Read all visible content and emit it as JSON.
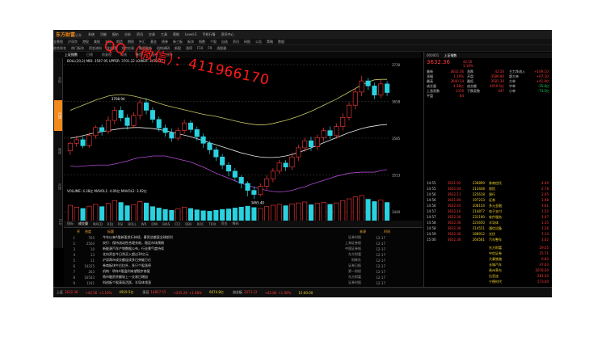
{
  "app": {
    "title": "东方财富",
    "subtitle": "证券"
  },
  "menu": [
    "系统",
    "功能",
    "报价",
    "分析",
    "资讯",
    "交易",
    "工具",
    "帮助",
    "Level-2",
    "手机行情",
    "资讯中心"
  ],
  "toolbar2": [
    "全景图",
    "沪深京",
    "港股",
    "美股",
    "全球",
    "期货",
    "期权",
    "外汇",
    "基金",
    "债券",
    "新三板",
    "板块",
    "指数",
    "个股",
    "自选",
    "资讯",
    "研报",
    "公告",
    "策略",
    "数据"
  ],
  "toolbar3": [
    "综合排名",
    "热门板块",
    "资金流向",
    "龙虎榜",
    "大宗交易",
    "融资融券",
    "机构调研",
    "新股",
    "涨停",
    "F10",
    "F9",
    "选股器"
  ],
  "chart_header": {
    "name": "上证指数",
    "items": [
      "日线",
      "前复权",
      "均线",
      "叠加",
      "画线",
      "统计"
    ]
  },
  "chart_info": {
    "ma": "BOLL(20,2)  MID: 3597.95  UPPER: 3701.22  LOWER: 3472.31",
    "high_label": "3708.94",
    "low_label": "3465.40",
    "mid_label": "3611.94"
  },
  "side_labels": [
    "分时",
    "日线",
    "周线",
    "月线",
    "F10"
  ],
  "bottom_tabs": [
    "指标",
    "成交量",
    "MACD",
    "KDJ",
    "RSI",
    "BOLL",
    "WR",
    "DMI",
    "BIAS",
    "CCI",
    "OBV",
    "ROC",
    "TRIX",
    "资金",
    "筹码"
  ],
  "vol_info": "VOLUME: 4.38亿  MAVOL1: 4.00亿  MAVOL2: 3.92亿",
  "news": {
    "header": [
      "序",
      "热度",
      "标题",
      "来源",
      "时间"
    ],
    "rows": [
      {
        "id": "1",
        "num": "765",
        "txt": "今年以来A股新股发行持续，募资总额居全球前列",
        "src": "证券时报",
        "tm": "12-17"
      },
      {
        "id": "2",
        "num": "2504",
        "txt": "央行：保持流动性合理充裕，稳定市场预期",
        "src": "上海证券报",
        "tm": "12-17"
      },
      {
        "id": "3",
        "num": "10",
        "txt": "新能源汽车产销数据公布，行业景气度持续",
        "src": "中国证券报",
        "tm": "12-17"
      },
      {
        "id": "4",
        "num": "13",
        "txt": "北向资金今日净买入超过30亿元",
        "src": "东方财富",
        "tm": "12-17"
      },
      {
        "id": "5",
        "num": "11",
        "txt": "沪深两市成交额连续多日突破万亿",
        "src": "财联社",
        "tm": "12-17"
      },
      {
        "id": "6",
        "num": "14225",
        "txt": "券商板块午后拉升，多只个股涨停",
        "src": "证券日报",
        "tm": "12-17"
      },
      {
        "id": "7",
        "num": "263",
        "txt": "机构：明年A股盈利有望稳步修复",
        "src": "第一财经",
        "tm": "12-17"
      },
      {
        "id": "8",
        "num": "16543",
        "txt": "两市融资余额较上一交易日增加",
        "src": "东方财富",
        "tm": "12-17"
      },
      {
        "id": "9",
        "num": "1241",
        "txt": "科创板个股表现活跃，半导体领涨",
        "src": "证券时报",
        "tm": "12-17"
      }
    ]
  },
  "quote": {
    "title": "上证指数",
    "code": "000001",
    "price": "3632.36",
    "change": "42.56",
    "pct": "1.19%",
    "fields": [
      {
        "k": "最新",
        "v": "3632.36"
      },
      {
        "k": "涨跌",
        "v": "42.56"
      },
      {
        "k": "涨幅",
        "v": "1.19%"
      },
      {
        "k": "开盘",
        "v": "3589.80"
      },
      {
        "k": "最高",
        "v": "3640.14"
      },
      {
        "k": "最低",
        "v": "3581.30"
      },
      {
        "k": "成交量",
        "v": "4.38亿"
      },
      {
        "k": "成交额",
        "v": "4919.5亿"
      },
      {
        "k": "上涨家数",
        "v": "1376"
      },
      {
        "k": "下跌家数",
        "v": "447"
      },
      {
        "k": "平盘",
        "v": "84"
      }
    ],
    "flow": [
      {
        "k": "主力净流入",
        "v": "+109.1亿"
      },
      {
        "k": "超大单",
        "v": "+67.2亿"
      },
      {
        "k": "大单",
        "v": "+41.9亿"
      },
      {
        "k": "中单",
        "v": "-35.6亿"
      },
      {
        "k": "小单",
        "v": "-73.5亿"
      }
    ],
    "ticks": [
      {
        "t": "14:55",
        "p": "3631.92",
        "v": "236899"
      },
      {
        "t": "14:55",
        "p": "3632.04",
        "v": "213448"
      },
      {
        "t": "14:56",
        "p": "3632.11",
        "v": "225618"
      },
      {
        "t": "14:56",
        "p": "3631.80",
        "v": "197233"
      },
      {
        "t": "14:56",
        "p": "3632.45",
        "v": "208154"
      },
      {
        "t": "14:57",
        "p": "3632.10",
        "v": "214877"
      },
      {
        "t": "14:57",
        "p": "3632.36",
        "v": "231190"
      },
      {
        "t": "14:58",
        "p": "3632.36",
        "v": "223650"
      },
      {
        "t": "14:58",
        "p": "3632.36",
        "v": "214551"
      },
      {
        "t": "14:59",
        "p": "3632.36",
        "v": "188912"
      },
      {
        "t": "15:00",
        "p": "3632.36",
        "v": "264561"
      }
    ],
    "sectors": [
      {
        "n": "券商信托",
        "p": "4.49"
      },
      {
        "n": "保险",
        "p": "2.78"
      },
      {
        "n": "银行",
        "p": "2.05"
      },
      {
        "n": "证券",
        "p": "1.98"
      },
      {
        "n": "多元金融",
        "p": "1.61"
      },
      {
        "n": "电子支付",
        "p": "1.52"
      },
      {
        "n": "软件服务",
        "p": "1.47"
      },
      {
        "n": "半导体",
        "p": "1.35"
      },
      {
        "n": "通信设备",
        "p": "1.26"
      },
      {
        "n": "光伏",
        "p": "1.14"
      },
      {
        "n": "汽车整车",
        "p": "1.02"
      }
    ],
    "stocks": [
      {
        "n": "东方财富",
        "p": "29.05"
      },
      {
        "n": "中信证券",
        "p": "25.71"
      },
      {
        "n": "大秦铁路",
        "p": "6.82"
      },
      {
        "n": "长城汽车",
        "p": "47.63"
      },
      {
        "n": "贵州茅台",
        "p": "2078.00"
      },
      {
        "n": "比亚迪",
        "p": "281.50"
      },
      {
        "n": "宁德时代",
        "p": "573.00"
      }
    ]
  },
  "status": [
    {
      "t": "上证",
      "v": "3632.36"
    },
    {
      "t": "+42.56",
      "v": "+1.19%"
    },
    {
      "t": "4919.5亿",
      "v": ""
    },
    {
      "t": "深证",
      "v": "14857.55"
    },
    {
      "t": "+245.26",
      "v": "+1.68%"
    },
    {
      "t": "6674.8亿",
      "v": ""
    },
    {
      "t": "创业板",
      "v": "3373.12"
    },
    {
      "t": "+62.80",
      "v": "+1.90%"
    },
    {
      "t": "15:00:00",
      "v": ""
    }
  ],
  "watermark": "QQ（微信）：411966170",
  "chart_data": {
    "type": "candlestick",
    "ylim": [
      3440,
      3730
    ],
    "candles": [
      [
        3560,
        3575,
        3552,
        3578
      ],
      [
        3575,
        3582,
        3568,
        3590
      ],
      [
        3582,
        3570,
        3565,
        3588
      ],
      [
        3570,
        3590,
        3566,
        3596
      ],
      [
        3590,
        3606,
        3584,
        3610
      ],
      [
        3606,
        3598,
        3590,
        3612
      ],
      [
        3598,
        3620,
        3594,
        3628
      ],
      [
        3620,
        3640,
        3612,
        3646
      ],
      [
        3640,
        3625,
        3618,
        3648
      ],
      [
        3625,
        3610,
        3602,
        3632
      ],
      [
        3610,
        3630,
        3604,
        3636
      ],
      [
        3630,
        3655,
        3622,
        3662
      ],
      [
        3655,
        3640,
        3632,
        3664
      ],
      [
        3640,
        3622,
        3615,
        3646
      ],
      [
        3622,
        3605,
        3598,
        3628
      ],
      [
        3605,
        3596,
        3588,
        3612
      ],
      [
        3596,
        3585,
        3578,
        3604
      ],
      [
        3585,
        3600,
        3580,
        3606
      ],
      [
        3600,
        3615,
        3594,
        3622
      ],
      [
        3615,
        3602,
        3596,
        3620
      ],
      [
        3602,
        3588,
        3580,
        3608
      ],
      [
        3588,
        3575,
        3566,
        3594
      ],
      [
        3575,
        3562,
        3554,
        3580
      ],
      [
        3562,
        3548,
        3540,
        3568
      ],
      [
        3548,
        3532,
        3524,
        3554
      ],
      [
        3532,
        3520,
        3510,
        3538
      ],
      [
        3520,
        3508,
        3500,
        3526
      ],
      [
        3508,
        3496,
        3486,
        3512
      ],
      [
        3496,
        3482,
        3470,
        3500
      ],
      [
        3482,
        3474,
        3465,
        3490
      ],
      [
        3474,
        3490,
        3470,
        3496
      ],
      [
        3490,
        3505,
        3484,
        3512
      ],
      [
        3505,
        3520,
        3498,
        3526
      ],
      [
        3520,
        3536,
        3514,
        3542
      ],
      [
        3536,
        3528,
        3520,
        3542
      ],
      [
        3528,
        3548,
        3522,
        3556
      ],
      [
        3548,
        3566,
        3540,
        3572
      ],
      [
        3566,
        3580,
        3558,
        3586
      ],
      [
        3580,
        3568,
        3560,
        3588
      ],
      [
        3568,
        3586,
        3562,
        3592
      ],
      [
        3586,
        3600,
        3578,
        3606
      ],
      [
        3600,
        3590,
        3584,
        3608
      ],
      [
        3590,
        3608,
        3584,
        3614
      ],
      [
        3608,
        3626,
        3600,
        3634
      ],
      [
        3626,
        3650,
        3620,
        3656
      ],
      [
        3650,
        3676,
        3642,
        3684
      ],
      [
        3676,
        3698,
        3668,
        3708
      ],
      [
        3698,
        3688,
        3680,
        3704
      ],
      [
        3688,
        3670,
        3662,
        3694
      ],
      [
        3670,
        3692,
        3664,
        3700
      ],
      [
        3692,
        3675,
        3668,
        3698
      ]
    ],
    "upper": [
      3640,
      3645,
      3650,
      3655,
      3660,
      3664,
      3668,
      3670,
      3671,
      3670,
      3668,
      3665,
      3662,
      3658,
      3654,
      3650,
      3647,
      3644,
      3641,
      3638,
      3635,
      3632,
      3630,
      3628,
      3625,
      3622,
      3619,
      3616,
      3614,
      3612,
      3611,
      3612,
      3614,
      3617,
      3620,
      3624,
      3628,
      3633,
      3638,
      3644,
      3650,
      3656,
      3662,
      3669,
      3676,
      3683,
      3690,
      3696,
      3700,
      3701,
      3701
    ],
    "mid": [
      3585,
      3587,
      3590,
      3593,
      3596,
      3598,
      3600,
      3602,
      3604,
      3605,
      3606,
      3606,
      3605,
      3604,
      3602,
      3600,
      3597,
      3594,
      3591,
      3588,
      3584,
      3580,
      3576,
      3572,
      3568,
      3564,
      3560,
      3556,
      3553,
      3550,
      3548,
      3547,
      3547,
      3548,
      3550,
      3553,
      3557,
      3561,
      3566,
      3571,
      3576,
      3581,
      3586,
      3591,
      3596,
      3600,
      3604,
      3607,
      3609,
      3611,
      3612
    ],
    "lower": [
      3530,
      3529,
      3530,
      3531,
      3532,
      3532,
      3532,
      3534,
      3537,
      3540,
      3544,
      3547,
      3548,
      3550,
      3550,
      3550,
      3547,
      3544,
      3541,
      3538,
      3533,
      3528,
      3522,
      3516,
      3511,
      3506,
      3501,
      3496,
      3492,
      3488,
      3485,
      3482,
      3480,
      3479,
      3480,
      3482,
      3486,
      3489,
      3494,
      3498,
      3502,
      3506,
      3510,
      3513,
      3516,
      3517,
      3518,
      3518,
      3518,
      3521,
      3523
    ],
    "volume": [
      42,
      38,
      35,
      40,
      44,
      39,
      46,
      52,
      48,
      41,
      43,
      50,
      47,
      39,
      36,
      33,
      31,
      34,
      38,
      35,
      32,
      30,
      29,
      31,
      33,
      34,
      36,
      38,
      40,
      37,
      35,
      39,
      42,
      44,
      41,
      45,
      47,
      49,
      43,
      46,
      48,
      44,
      47,
      52,
      56,
      60,
      63,
      55,
      50,
      53,
      48
    ]
  }
}
